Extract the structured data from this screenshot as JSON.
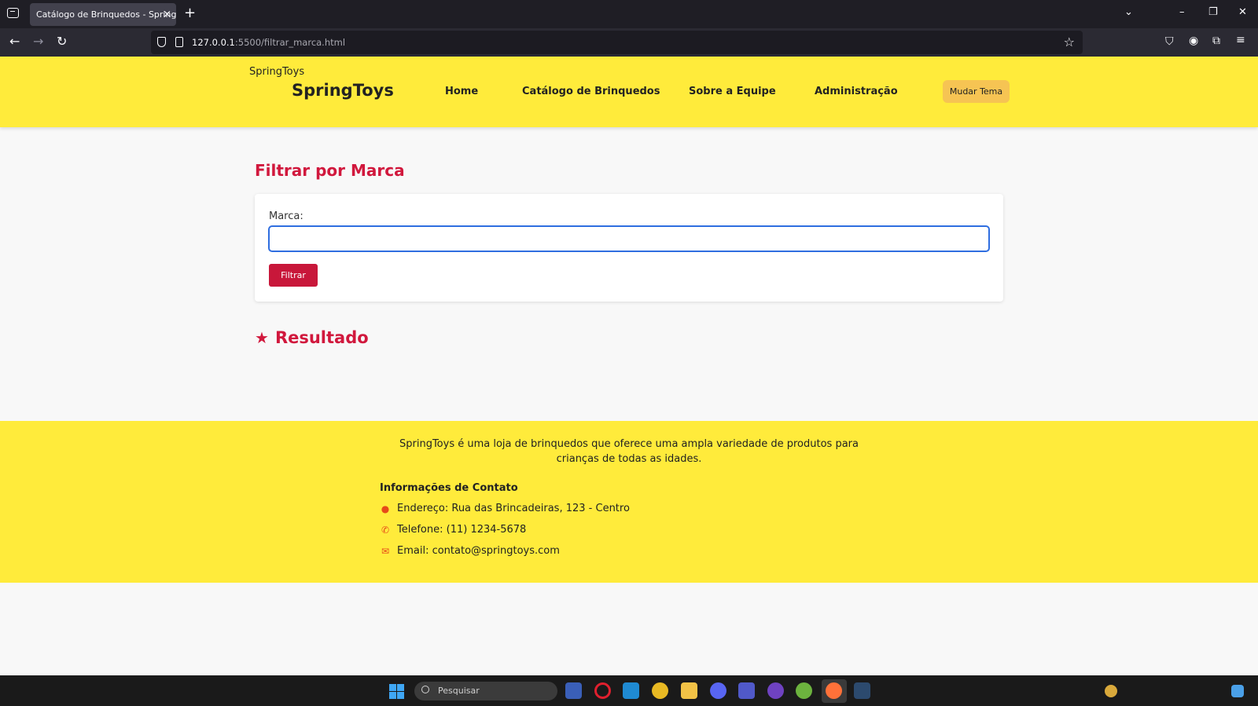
{
  "browser": {
    "tab_title": "Catálogo de Brinquedos - SpringToys",
    "tab_close": "×",
    "new_tab": "+",
    "url_host": "127.0.0.1",
    "url_path": ":5500/filtrar_marca.html",
    "window_controls": [
      "⌄",
      "–",
      "❐",
      "✕"
    ]
  },
  "header": {
    "logo_small": "SpringToys",
    "logo_big": "SpringToys",
    "menu": [
      "Home",
      "Catálogo de Brinquedos",
      "Sobre a Equipe",
      "Administração"
    ],
    "theme_button": "Mudar Tema"
  },
  "main": {
    "title": "Filtrar por Marca",
    "field_label": "Marca:",
    "input_value": "",
    "filter_button": "Filtrar",
    "result_title": "Resultado"
  },
  "footer": {
    "about": "SpringToys é uma loja de brinquedos que oferece uma ampla variedade de produtos para crianças de todas as idades.",
    "contact_title": "Informações de Contato",
    "address": "Endereço: Rua das Brincadeiras, 123 - Centro",
    "phone": "Telefone: (11) 1234-5678",
    "email": "Email: contato@springtoys.com"
  },
  "taskbar": {
    "search_placeholder": "Pesquisar"
  },
  "colors": {
    "header_bg": "#ffeb3b",
    "accent": "#d1183d",
    "theme_button": "#f6c453",
    "input_focus": "#2f6ee0"
  }
}
